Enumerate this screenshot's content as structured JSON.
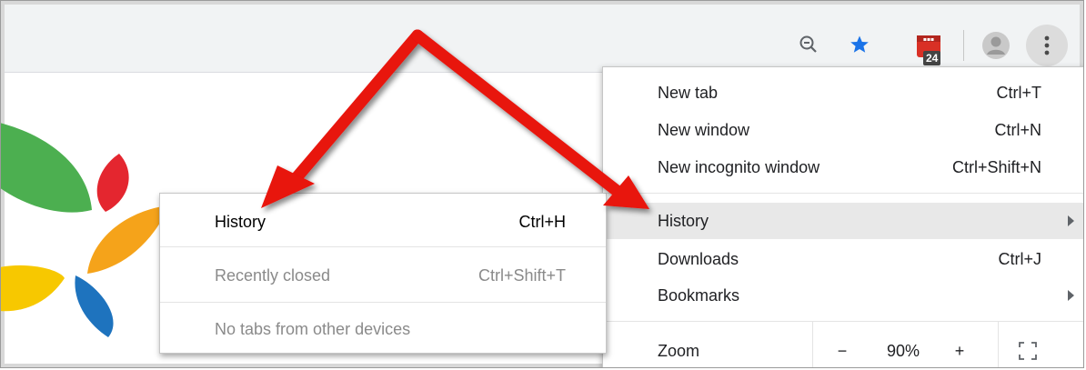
{
  "toolbar": {
    "zoom_icon": "zoom-out-icon",
    "star_icon": "bookmark-star-icon",
    "extension_badge": "24",
    "avatar_icon": "profile-avatar-icon",
    "menu_icon": "kebab-menu-icon",
    "star_color": "#1a73e8",
    "extension_color": "#d93025"
  },
  "main_menu": {
    "items": [
      {
        "label": "New tab",
        "shortcut": "Ctrl+T"
      },
      {
        "label": "New window",
        "shortcut": "Ctrl+N"
      },
      {
        "label": "New incognito window",
        "shortcut": "Ctrl+Shift+N"
      },
      {
        "label": "History",
        "shortcut": ""
      },
      {
        "label": "Downloads",
        "shortcut": "Ctrl+J"
      },
      {
        "label": "Bookmarks",
        "shortcut": ""
      }
    ],
    "zoom": {
      "label": "Zoom",
      "minus": "−",
      "value": "90%",
      "plus": "+"
    }
  },
  "history_submenu": {
    "items": [
      {
        "label": "History",
        "shortcut": "Ctrl+H"
      },
      {
        "label": "Recently closed",
        "shortcut": "Ctrl+Shift+T"
      },
      {
        "label": "No tabs from other devices",
        "shortcut": ""
      }
    ]
  },
  "colors": {
    "arrow": "#e8120c",
    "highlight": "#e8e8e8"
  }
}
